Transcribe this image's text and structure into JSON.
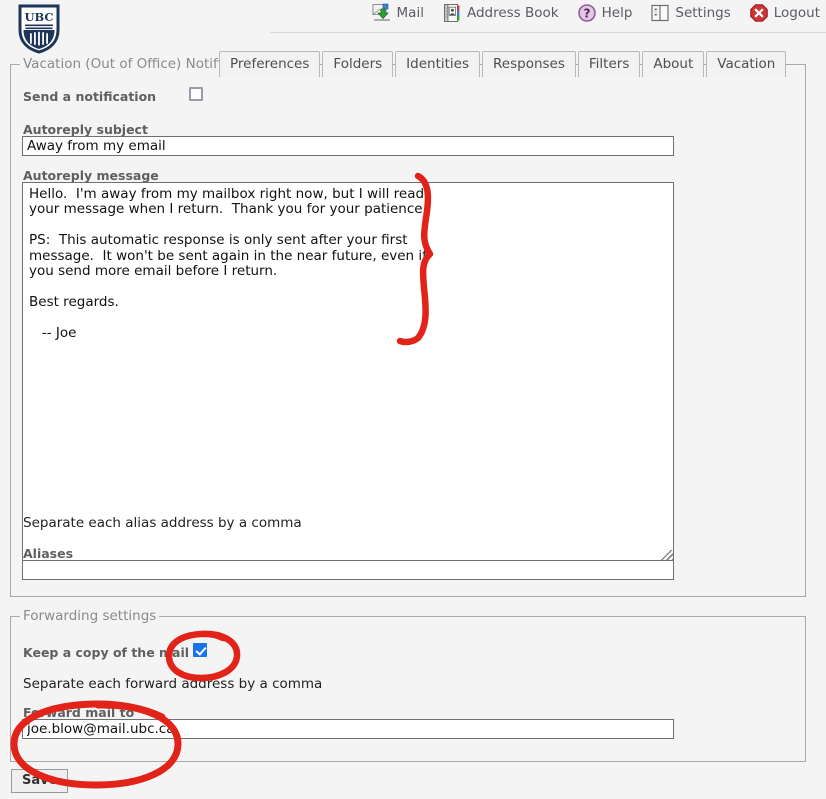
{
  "app": {
    "logo_text": "UBC",
    "logo_name": "ubc-shield-logo"
  },
  "toolbar": {
    "items": [
      {
        "label": "Mail",
        "icon": "mail-icon"
      },
      {
        "label": "Address Book",
        "icon": "address-book-icon"
      },
      {
        "label": "Help",
        "icon": "help-icon"
      },
      {
        "label": "Settings",
        "icon": "settings-icon"
      },
      {
        "label": "Logout",
        "icon": "logout-icon"
      }
    ]
  },
  "tabs": [
    {
      "label": "Preferences",
      "selected": false
    },
    {
      "label": "Folders",
      "selected": false
    },
    {
      "label": "Identities",
      "selected": false
    },
    {
      "label": "Responses",
      "selected": false
    },
    {
      "label": "Filters",
      "selected": false
    },
    {
      "label": "About",
      "selected": false
    },
    {
      "label": "Vacation",
      "selected": true
    }
  ],
  "vacation": {
    "legend": "Vacation (Out of Office) Notification",
    "send_notification_label": "Send a notification",
    "send_notification_checked": false,
    "subject_label": "Autoreply subject",
    "subject_value": "Away from my email",
    "message_label": "Autoreply message",
    "message_value": "Hello.  I'm away from my mailbox right now, but I will read\nyour message when I return.  Thank you for your patience.\n\nPS:  This automatic response is only sent after your first\nmessage.  It won't be sent again in the near future, even if\nyou send more email before I return.\n\nBest regards.\n\n   -- Joe",
    "alias_hint": "Separate each alias address by a comma",
    "aliases_label": "Aliases",
    "aliases_value": ""
  },
  "forwarding": {
    "legend": "Forwarding settings",
    "keep_copy_label": "Keep a copy of the mail",
    "keep_copy_checked": true,
    "forward_hint": "Separate each forward address by a comma",
    "forward_label": "Forward mail to",
    "forward_value": "joe.blow@mail.ubc.ca"
  },
  "actions": {
    "save_label": "Save"
  },
  "annotations": {
    "color": "#e2231a",
    "shapes": [
      {
        "name": "brace-around-message",
        "type": "curly-brace"
      },
      {
        "name": "circle-around-keep-copy",
        "type": "ellipse"
      },
      {
        "name": "circle-around-forward-to",
        "type": "ellipse"
      }
    ]
  },
  "colors": {
    "page_bg": "#f4f4f4",
    "fieldset_border": "#aaaaaa",
    "legend_text": "#8a8a8a",
    "label_text": "#5f5f5f",
    "checkbox_checked": "#1a73e8",
    "annotation_red": "#e2231a",
    "logo_navy": "#1d3557"
  }
}
